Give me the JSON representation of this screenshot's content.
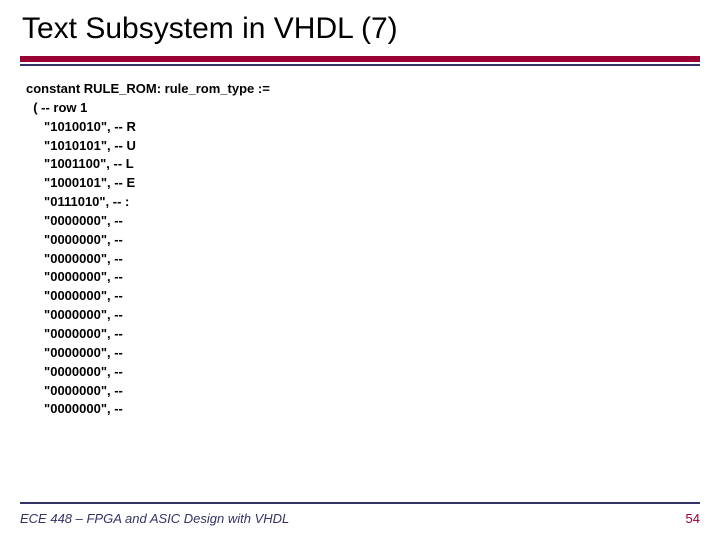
{
  "title": "Text Subsystem in VHDL (7)",
  "code": "constant RULE_ROM: rule_rom_type :=\n  ( -- row 1\n     \"1010010\", -- R\n     \"1010101\", -- U\n     \"1001100\", -- L\n     \"1000101\", -- E\n     \"0111010\", -- :\n     \"0000000\", --\n     \"0000000\", --\n     \"0000000\", --\n     \"0000000\", --\n     \"0000000\", --\n     \"0000000\", --\n     \"0000000\", --\n     \"0000000\", --\n     \"0000000\", --\n     \"0000000\", --\n     \"0000000\", --",
  "footer": {
    "course": "ECE 448 – FPGA and ASIC Design with VHDL",
    "page": "54"
  }
}
